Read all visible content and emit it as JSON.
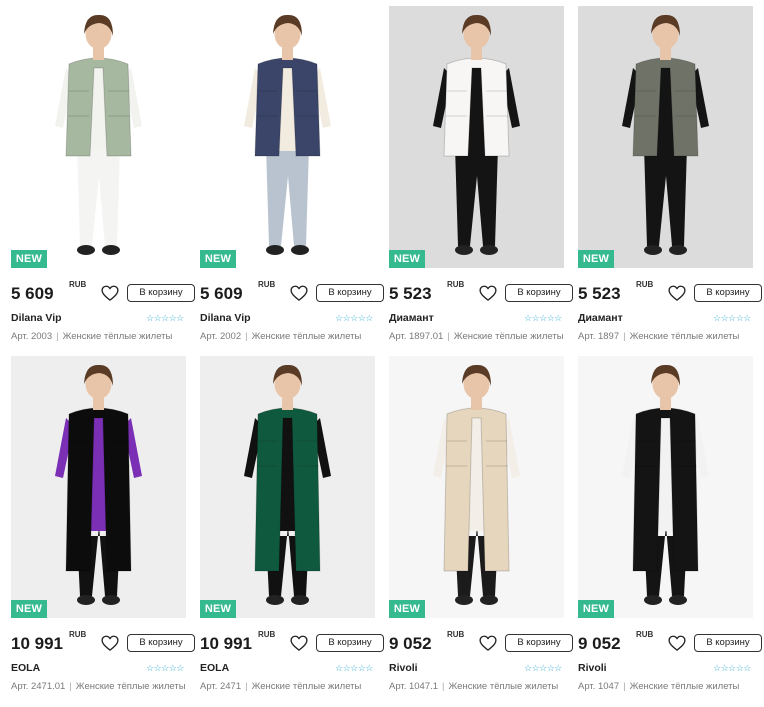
{
  "products": [
    {
      "badge": "NEW",
      "price": "5 609",
      "currency": "RUB",
      "cart": "В корзину",
      "brand": "Dilana Vip",
      "rating": "☆☆☆☆☆",
      "article": "Арт. 2003",
      "category": "Женские тёплые жилеты",
      "colors": {
        "vest": "#a7b8a0",
        "under": "#f2f2ef",
        "pants": "#f4f4f2",
        "bg": "#ffffff"
      }
    },
    {
      "badge": "NEW",
      "price": "5 609",
      "currency": "RUB",
      "cart": "В корзину",
      "brand": "Dilana Vip",
      "rating": "☆☆☆☆☆",
      "article": "Арт. 2002",
      "category": "Женские тёплые жилеты",
      "colors": {
        "vest": "#3a4569",
        "under": "#f1ebe0",
        "pants": "#b9c3cf",
        "bg": "#ffffff"
      }
    },
    {
      "badge": "NEW",
      "price": "5 523",
      "currency": "RUB",
      "cart": "В корзину",
      "brand": "Диамант",
      "rating": "☆☆☆☆☆",
      "article": "Арт. 1897.01",
      "category": "Женские тёплые жилеты",
      "colors": {
        "vest": "#f7f6f4",
        "under": "#141414",
        "pants": "#141414",
        "bg": "#dcdcdc"
      }
    },
    {
      "badge": "NEW",
      "price": "5 523",
      "currency": "RUB",
      "cart": "В корзину",
      "brand": "Диамант",
      "rating": "☆☆☆☆☆",
      "article": "Арт. 1897",
      "category": "Женские тёплые жилеты",
      "colors": {
        "vest": "#6e7267",
        "under": "#141414",
        "pants": "#141414",
        "bg": "#dcdcdc"
      }
    },
    {
      "badge": "NEW",
      "price": "10 991",
      "currency": "RUB",
      "cart": "В корзину",
      "brand": "EOLA",
      "rating": "☆☆☆☆☆",
      "article": "Арт. 2471.01",
      "category": "Женские тёплые жилеты",
      "colors": {
        "vest": "#0c0c0c",
        "under": "#7a2fb5",
        "pants": "#111111",
        "bg": "#eeeeee"
      }
    },
    {
      "badge": "NEW",
      "price": "10 991",
      "currency": "RUB",
      "cart": "В корзину",
      "brand": "EOLA",
      "rating": "☆☆☆☆☆",
      "article": "Арт. 2471",
      "category": "Женские тёплые жилеты",
      "colors": {
        "vest": "#0f5a3f",
        "under": "#111111",
        "pants": "#111111",
        "bg": "#eeeeee"
      }
    },
    {
      "badge": "NEW",
      "price": "9 052",
      "currency": "RUB",
      "cart": "В корзину",
      "brand": "Rivoli",
      "rating": "☆☆☆☆☆",
      "article": "Арт. 1047.1",
      "category": "Женские тёплые жилеты",
      "colors": {
        "vest": "#e6d6bd",
        "under": "#f3efe8",
        "pants": "#1b1b1b",
        "bg": "#f6f6f6"
      }
    },
    {
      "badge": "NEW",
      "price": "9 052",
      "currency": "RUB",
      "cart": "В корзину",
      "brand": "Rivoli",
      "rating": "☆☆☆☆☆",
      "article": "Арт. 1047",
      "category": "Женские тёплые жилеты",
      "colors": {
        "vest": "#141414",
        "under": "#f2f2f2",
        "pants": "#141414",
        "bg": "#f6f6f6"
      }
    }
  ]
}
